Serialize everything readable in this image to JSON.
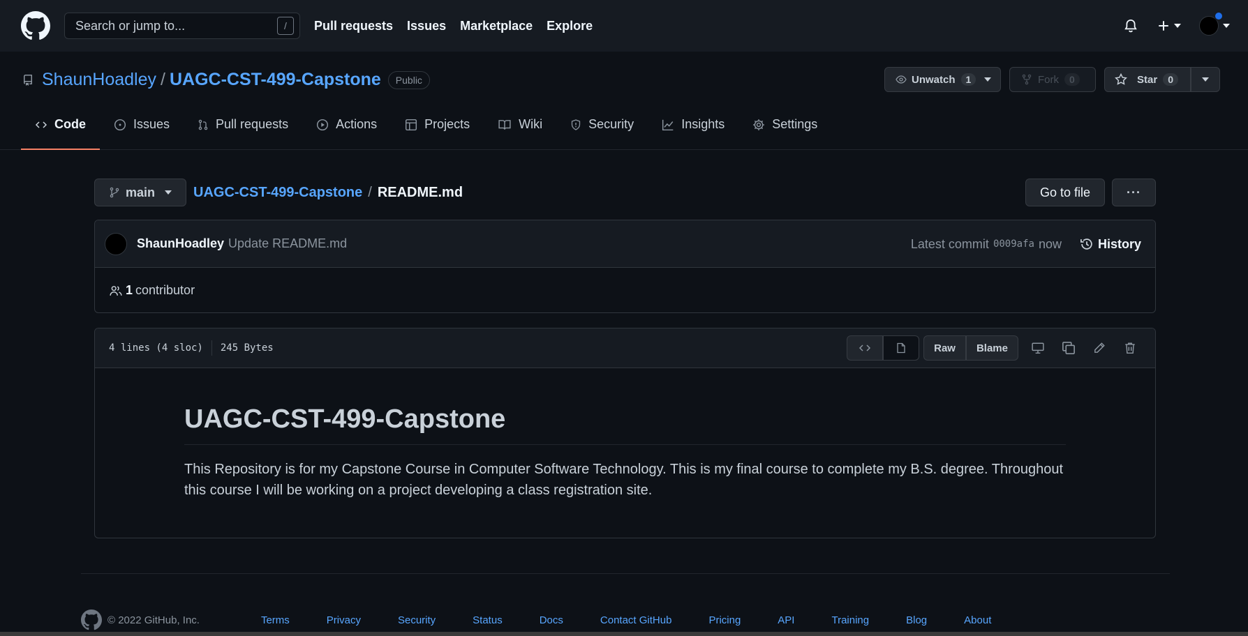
{
  "header": {
    "search_placeholder": "Search or jump to...",
    "search_shortcut": "/",
    "nav": [
      "Pull requests",
      "Issues",
      "Marketplace",
      "Explore"
    ]
  },
  "repo": {
    "owner": "ShaunHoadley",
    "separator": "/",
    "name": "UAGC-CST-499-Capstone",
    "visibility": "Public",
    "unwatch_label": "Unwatch",
    "watch_count": "1",
    "fork_label": "Fork",
    "fork_count": "0",
    "star_label": "Star",
    "star_count": "0"
  },
  "tabs": [
    {
      "label": "Code",
      "icon": "code-icon",
      "active": true
    },
    {
      "label": "Issues",
      "icon": "issue-icon"
    },
    {
      "label": "Pull requests",
      "icon": "pull-request-icon"
    },
    {
      "label": "Actions",
      "icon": "play-icon"
    },
    {
      "label": "Projects",
      "icon": "table-icon"
    },
    {
      "label": "Wiki",
      "icon": "book-icon"
    },
    {
      "label": "Security",
      "icon": "shield-icon"
    },
    {
      "label": "Insights",
      "icon": "graph-icon"
    },
    {
      "label": "Settings",
      "icon": "gear-icon"
    }
  ],
  "file_nav": {
    "branch": "main",
    "repo_link": "UAGC-CST-499-Capstone",
    "separator": "/",
    "file_name": "README.md",
    "goto_label": "Go to file",
    "more_label": "···"
  },
  "commit": {
    "author": "ShaunHoadley",
    "message": "Update README.md",
    "latest_label": "Latest commit",
    "sha": "0009afa",
    "time": "now",
    "history_label": "History"
  },
  "contributors": {
    "count": "1",
    "label": "contributor"
  },
  "file_info": {
    "lines": "4 lines (4 sloc)",
    "size": "245 Bytes",
    "raw_label": "Raw",
    "blame_label": "Blame"
  },
  "readme": {
    "heading": "UAGC-CST-499-Capstone",
    "body": "This Repository is for my Capstone Course in Computer Software Technology. This is my final course to complete my B.S. degree. Throughout this course I will be working on a project developing a class registration site."
  },
  "footer": {
    "copyright": "© 2022 GitHub, Inc.",
    "links": [
      "Terms",
      "Privacy",
      "Security",
      "Status",
      "Docs",
      "Contact GitHub",
      "Pricing",
      "API",
      "Training",
      "Blog",
      "About"
    ]
  },
  "colors": {
    "background": "#0d1117",
    "header_bg": "#161b22",
    "link": "#58a6ff",
    "active_tab_underline": "#f78166",
    "notification_dot": "#1f6feb"
  }
}
